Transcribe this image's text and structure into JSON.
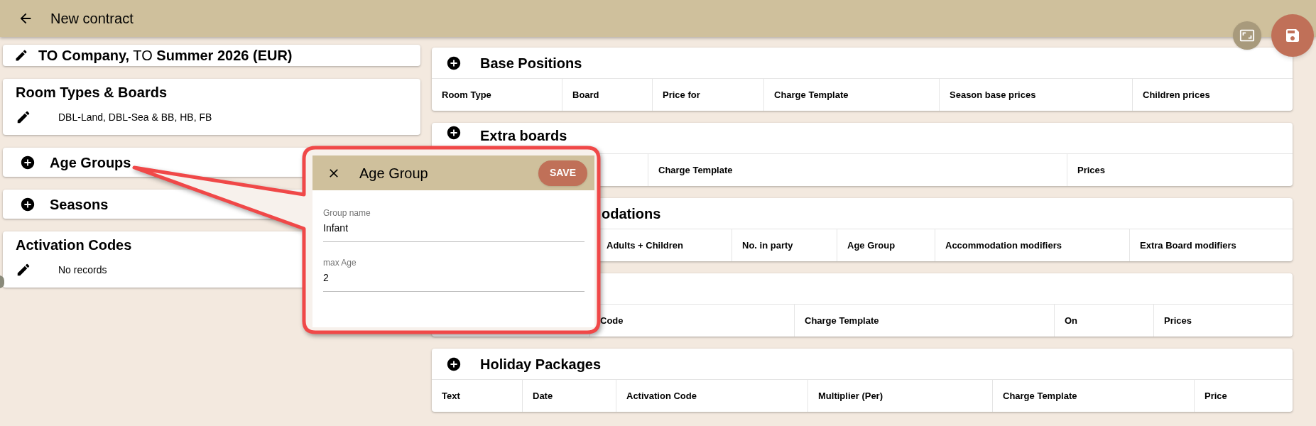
{
  "header": {
    "title": "New contract"
  },
  "contract": {
    "title": "**TO Company,** TO **Summer 2026 (EUR)**"
  },
  "left_cards": [
    {
      "kind": "list",
      "title": "Room Types & Boards",
      "text": "DBL-Land, DBL-Sea & BB, HB, FB"
    },
    {
      "kind": "add",
      "title": "Age Groups"
    },
    {
      "kind": "add",
      "title": "Seasons"
    },
    {
      "kind": "list",
      "title": "Activation Codes",
      "text": "No records"
    }
  ],
  "panels": [
    {
      "title": "Base Positions",
      "columns": [
        "Room Type",
        "Board",
        "Price for",
        "Charge Template",
        "Season base prices",
        "Children prices"
      ]
    },
    {
      "title": "Extra boards",
      "columns": [
        "Charge Template",
        "Prices"
      ]
    },
    {
      "title": "odations",
      "columns": [
        "Adults + Children",
        "No. in party",
        "Age Group",
        "Accommodation modifiers",
        "Extra Board modifiers"
      ]
    },
    {
      "columns": [
        "Code",
        "Charge Template",
        "On",
        "Prices"
      ]
    },
    {
      "title": "Holiday Packages",
      "columns": [
        "Text",
        "Date",
        "Activation Code",
        "Multiplier (Per)",
        "Charge Template",
        "Price"
      ]
    }
  ],
  "dialog": {
    "title": "Age Group",
    "save": "SAVE",
    "fields": [
      {
        "label": "Group name",
        "value": "Infant"
      },
      {
        "label": "max Age",
        "value": "2"
      }
    ]
  }
}
